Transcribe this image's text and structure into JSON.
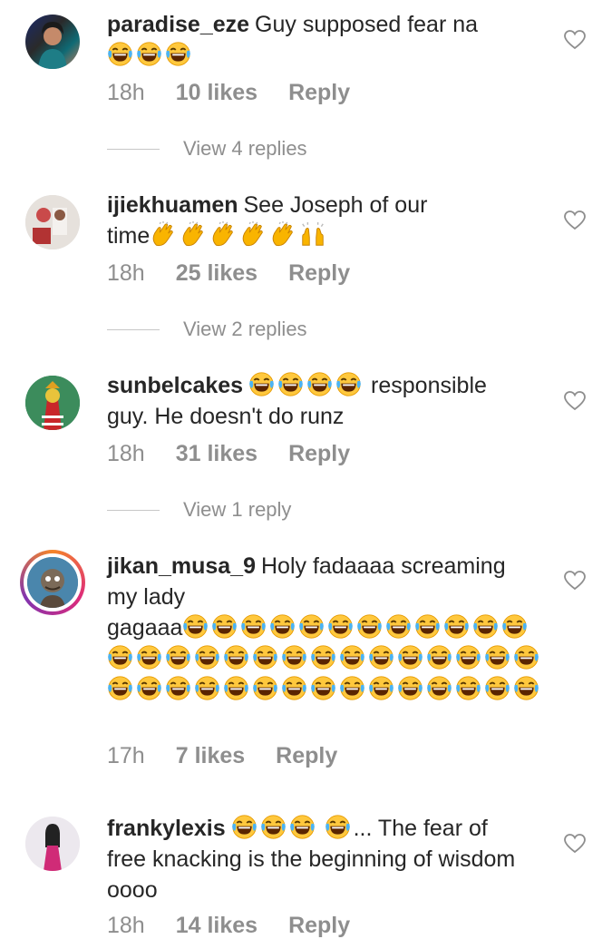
{
  "icons": {
    "heart": "heart-outline-icon",
    "laugh": "face-with-tears-of-joy-emoji",
    "clap": "clapping-hands-emoji",
    "raise": "raising-hands-emoji"
  },
  "colors": {
    "text": "#262626",
    "muted": "#8e8e8e",
    "story_ring": "#dd2a7b"
  },
  "comments": [
    {
      "username": "paradise_eze",
      "text": "Guy supposed fear na",
      "time": "18h",
      "likes": "10 likes",
      "reply": "Reply",
      "view_replies": "View 4 replies"
    },
    {
      "username": "ijiekhuamen",
      "text": "See Joseph of our",
      "text2": "time",
      "time": "18h",
      "likes": "25 likes",
      "reply": "Reply",
      "view_replies": "View 2 replies"
    },
    {
      "username": "sunbelcakes",
      "text": "responsible",
      "text2": "guy. He doesn't do runz",
      "time": "18h",
      "likes": "31 likes",
      "reply": "Reply",
      "view_replies": "View 1 reply"
    },
    {
      "username": "jikan_musa_9",
      "text": "Holy fadaaaa screaming",
      "text2": "my lady",
      "text3": "gagaaa",
      "time": "17h",
      "likes": "7 likes",
      "reply": "Reply"
    },
    {
      "username": "frankylexis",
      "text": "... The fear of",
      "text2": "free knacking is the beginning of wisdom",
      "text3": "oooo",
      "time": "18h",
      "likes": "14 likes",
      "reply": "Reply"
    }
  ]
}
